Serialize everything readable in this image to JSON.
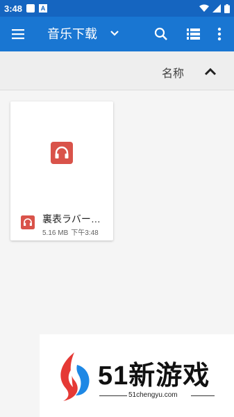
{
  "status_bar": {
    "time": "3:48",
    "icons": [
      "notification-square-icon",
      "a-app-icon",
      "wifi-icon",
      "signal-icon",
      "battery-icon"
    ],
    "background": "#1565c0"
  },
  "toolbar": {
    "title": "音乐下载",
    "background": "#1976d2",
    "icons": [
      "menu-icon",
      "chevron-down-icon",
      "search-icon",
      "list-view-icon",
      "more-vert-icon"
    ]
  },
  "sort": {
    "label": "名称",
    "direction_icon": "arrow-up-icon"
  },
  "files": [
    {
      "name": "裏表ラバー…",
      "size": "5.16 MB",
      "time": "下午3:48",
      "icon": "headphones-icon",
      "icon_color": "#d9534a"
    }
  ],
  "watermark": {
    "brand": "51新游戏",
    "url": "51chengyu.com",
    "logo_colors": [
      "#e53935",
      "#1e88e5"
    ]
  }
}
